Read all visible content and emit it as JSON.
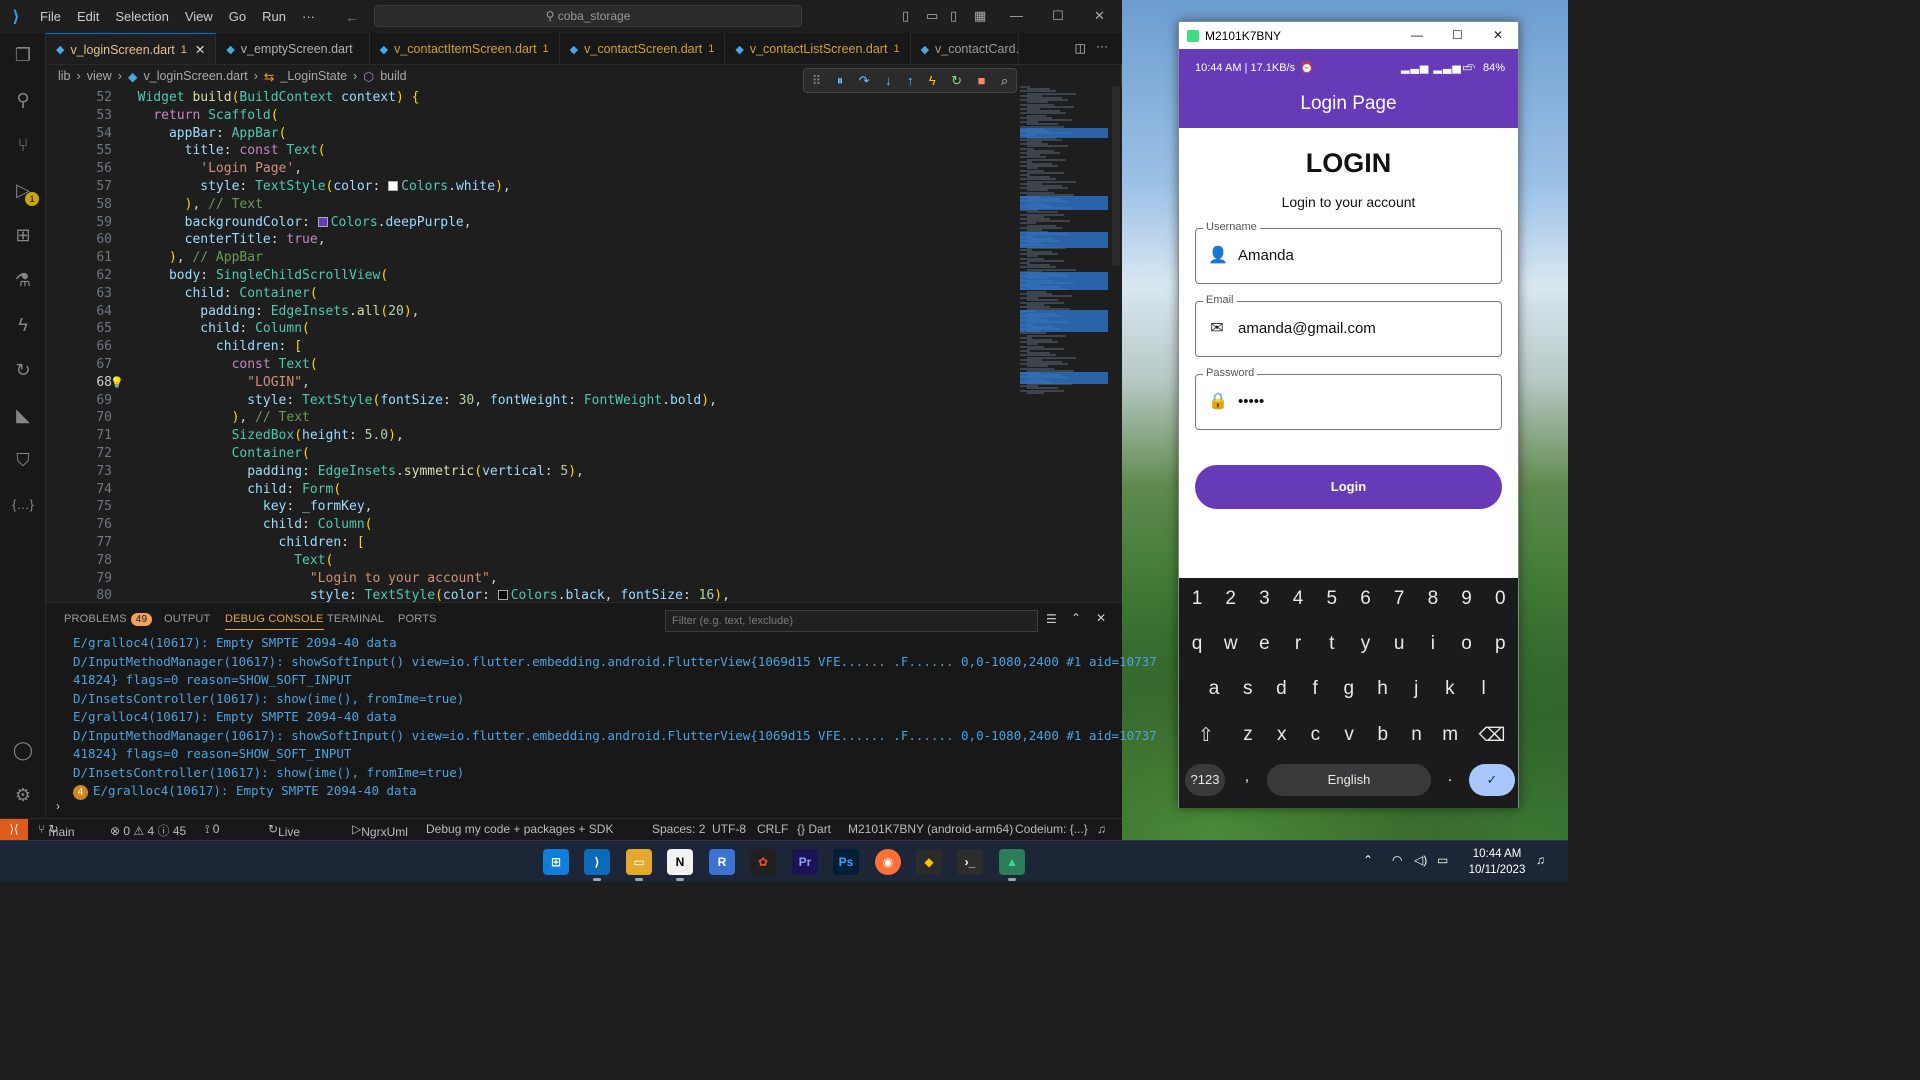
{
  "vscode": {
    "menu": [
      "File",
      "Edit",
      "Selection",
      "View",
      "Go",
      "Run",
      "···"
    ],
    "search_text": "coba_storage",
    "tabs": [
      {
        "label": "v_loginScreen.dart",
        "mod": "1",
        "active": true
      },
      {
        "label": "v_emptyScreen.dart",
        "mod": ""
      },
      {
        "label": "v_contactItemScreen.dart",
        "mod": "1"
      },
      {
        "label": "v_contactScreen.dart",
        "mod": "1"
      },
      {
        "label": "v_contactListScreen.dart",
        "mod": "1"
      },
      {
        "label": "v_contactCard.da",
        "mod": ""
      }
    ],
    "breadcrumb": [
      "lib",
      "view",
      "v_loginScreen.dart",
      "_LoginState",
      "build"
    ],
    "current_line": "68",
    "code_lines": [
      {
        "n": "52",
        "t": "  Widget build(BuildContext context) {"
      },
      {
        "n": "53",
        "t": "    return Scaffold("
      },
      {
        "n": "54",
        "t": "      appBar: AppBar("
      },
      {
        "n": "55",
        "t": "        title: const Text("
      },
      {
        "n": "56",
        "t": "          'Login Page',"
      },
      {
        "n": "57",
        "t": "          style: TextStyle(color: Colors.white),"
      },
      {
        "n": "58",
        "t": "        ), // Text"
      },
      {
        "n": "59",
        "t": "        backgroundColor: Colors.deepPurple,"
      },
      {
        "n": "60",
        "t": "        centerTitle: true,"
      },
      {
        "n": "61",
        "t": "      ), // AppBar"
      },
      {
        "n": "62",
        "t": "      body: SingleChildScrollView("
      },
      {
        "n": "63",
        "t": "        child: Container("
      },
      {
        "n": "64",
        "t": "          padding: EdgeInsets.all(20),"
      },
      {
        "n": "65",
        "t": "          child: Column("
      },
      {
        "n": "66",
        "t": "            children: ["
      },
      {
        "n": "67",
        "t": "              const Text("
      },
      {
        "n": "68",
        "t": "                \"LOGIN\","
      },
      {
        "n": "69",
        "t": "                style: TextStyle(fontSize: 30, fontWeight: FontWeight.bold),"
      },
      {
        "n": "70",
        "t": "              ), // Text"
      },
      {
        "n": "71",
        "t": "              SizedBox(height: 5.0),"
      },
      {
        "n": "72",
        "t": "              Container("
      },
      {
        "n": "73",
        "t": "                padding: EdgeInsets.symmetric(vertical: 5),"
      },
      {
        "n": "74",
        "t": "                child: Form("
      },
      {
        "n": "75",
        "t": "                  key: _formKey,"
      },
      {
        "n": "76",
        "t": "                  child: Column("
      },
      {
        "n": "77",
        "t": "                    children: ["
      },
      {
        "n": "78",
        "t": "                      Text("
      },
      {
        "n": "79",
        "t": "                        \"Login to your account\","
      },
      {
        "n": "80",
        "t": "                        style: TextStyle(color: Colors.black, fontSize: 16),"
      }
    ],
    "panel": {
      "tabs": [
        "PROBLEMS",
        "OUTPUT",
        "DEBUG CONSOLE",
        "TERMINAL",
        "PORTS"
      ],
      "problems_count": "49",
      "filter_placeholder": "Filter (e.g. text, !exclude)",
      "console": [
        "E/gralloc4(10617): Empty SMPTE 2094-40 data",
        "D/InputMethodManager(10617): showSoftInput() view=io.flutter.embedding.android.FlutterView{1069d15 VFE...... .F...... 0,0-1080,2400 #1 aid=10737",
        "41824} flags=0 reason=SHOW_SOFT_INPUT",
        "D/InsetsController(10617): show(ime(), fromIme=true)",
        "E/gralloc4(10617): Empty SMPTE 2094-40 data",
        "D/InputMethodManager(10617): showSoftInput() view=io.flutter.embedding.android.FlutterView{1069d15 VFE...... .F...... 0,0-1080,2400 #1 aid=10737",
        "41824} flags=0 reason=SHOW_SOFT_INPUT",
        "D/InsetsController(10617): show(ime(), fromIme=true)",
        "E/gralloc4(10617): Empty SMPTE 2094-40 data"
      ],
      "repeat_badge": "4"
    },
    "status": {
      "branch": "main",
      "problems": "⊗ 0 ⚠ 4 ⓘ 45",
      "ports": "⟟ 0",
      "liveshare": "Live Share",
      "ngrx": "NgrxUml",
      "debug": "Debug my code + packages + SDK",
      "spaces": "Spaces: 2",
      "encoding": "UTF-8",
      "eol": "CRLF",
      "lang": "{} Dart",
      "device": "M2101K7BNY (android-arm64)",
      "codeium": "Codeium: {...}"
    }
  },
  "phone": {
    "window_title": "M2101K7BNY",
    "status_left": "10:44 AM | 17.1KB/s",
    "battery": "84%",
    "appbar_title": "Login Page",
    "heading": "LOGIN",
    "subheading": "Login to your account",
    "fields": [
      {
        "label": "Username",
        "value": "Amanda"
      },
      {
        "label": "Email",
        "value": "amanda@gmail.com"
      },
      {
        "label": "Password",
        "value": "•••••"
      }
    ],
    "login_button": "Login",
    "keyboard": {
      "row1": [
        "1",
        "2",
        "3",
        "4",
        "5",
        "6",
        "7",
        "8",
        "9",
        "0"
      ],
      "row2": [
        "q",
        "w",
        "e",
        "r",
        "t",
        "y",
        "u",
        "i",
        "o",
        "p"
      ],
      "row3": [
        "a",
        "s",
        "d",
        "f",
        "g",
        "h",
        "j",
        "k",
        "l"
      ],
      "row4": [
        "z",
        "x",
        "c",
        "v",
        "b",
        "n",
        "m"
      ],
      "sym": "?123",
      "comma": ",",
      "space": "English",
      "period": "."
    }
  },
  "taskbar": {
    "time": "10:44 AM",
    "date": "10/11/2023"
  }
}
